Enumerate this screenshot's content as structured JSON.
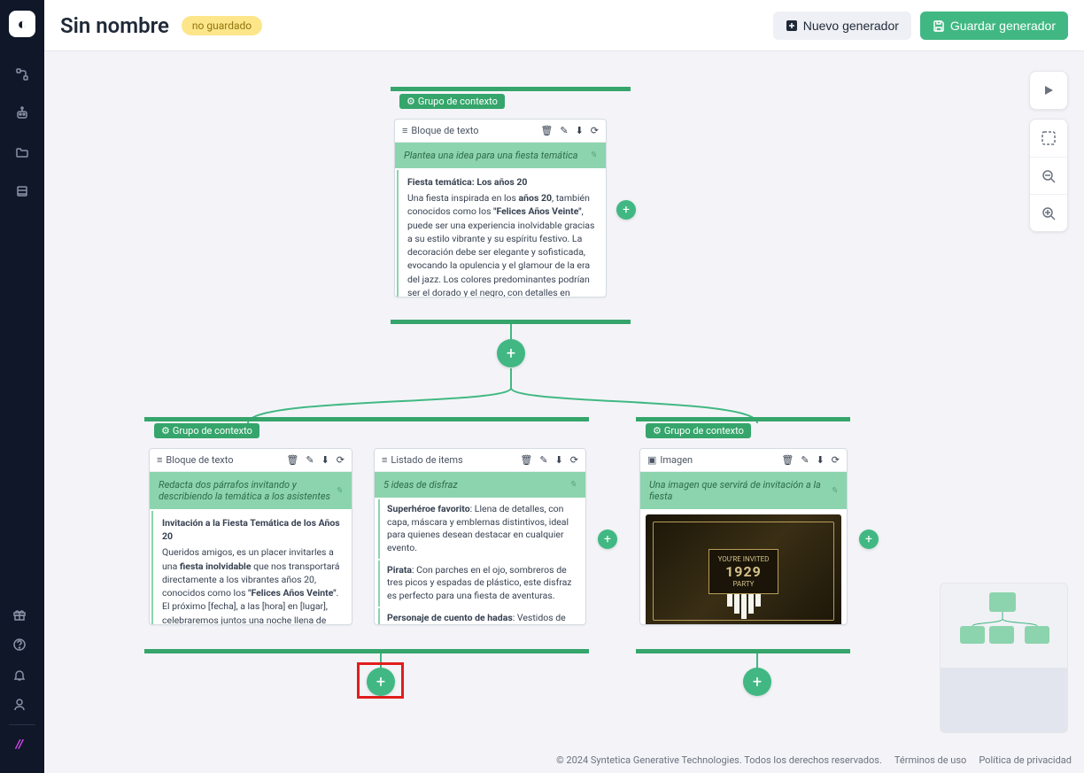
{
  "header": {
    "title": "Sin nombre",
    "unsaved_label": "no guardado",
    "new_generator": "Nuevo generador",
    "save_generator": "Guardar generador"
  },
  "group_labels": {
    "context_group": "Grupo de contexto"
  },
  "block_types": {
    "text_block": "Bloque de texto",
    "item_list": "Listado de items",
    "image": "Imagen"
  },
  "nodes": {
    "top": {
      "prompt": "Plantea una idea para una fiesta temática",
      "title": "Fiesta temática: Los años 20",
      "body_pre": "Una fiesta inspirada en los ",
      "bold1": "años 20",
      "body_mid1": ", también conocidos como los ",
      "bold2": "\"Felices Años Veinte\"",
      "body_post": ", puede ser una experiencia inolvidable gracias a su estilo vibrante y su espíritu festivo. La decoración debe ser elegante y sofisticada, evocando la opulencia y el glamour de la era del jazz. Los colores predominantes podrían ser el dorado y el negro, con detalles en blanco y plata para darle un toque más lujoso. Se pueden usar elementos decorativos como plumas, perlas, luces tenues y cortinas de cuentas para"
    },
    "left": {
      "prompt": "Redacta dos párrafos invitando y describiendo la temática a los asistentes",
      "title": "Invitación a la Fiesta Temática de los Años 20",
      "body_pre": "Queridos amigos, es un placer invitarles a una ",
      "bold1": "fiesta inolvidable",
      "body_mid1": " que nos transportará directamente a los vibrantes años 20, conocidos como los ",
      "bold2": "\"Felices Años Veinte\"",
      "body_post": ". El próximo [fecha], a las [hora] en [lugar], celebraremos juntos una noche llena de elegancia, glamour y mucho jazz. Prepárense para sumergirse en la opulencia de la era del charlestón, donde la decoración, la música y las actividades los harán sentir como en una auténtica fiesta de esa década. Les pedimos que vengan vestidos con la moda de los"
    },
    "middle": {
      "prompt": "5 ideas de disfraz",
      "items": [
        {
          "name": "Superhéroe favorito",
          "desc": ": Llena de detalles, con capa, máscara y emblemas distintivos, ideal para quienes desean destacar en cualquier evento."
        },
        {
          "name": "Pirata",
          "desc": ": Con parches en el ojo, sombreros de tres picos y espadas de plástico, este disfraz es perfecto para una fiesta de aventuras."
        },
        {
          "name": "Personaje de cuento de hadas",
          "desc": ": Vestidos de princesas, dragones o hadas con alitas y varitas mágicas, siempre un clásico para cualquier temática."
        }
      ]
    },
    "right": {
      "prompt": "Una imagen que servirá de invitación a la fiesta",
      "inv_top": "YOU'RE INVITED",
      "inv_year": "1929",
      "inv_party": "PARTY"
    }
  },
  "footer": {
    "copyright": "© 2024 Syntetica Generative Technologies. Todos los derechos reservados.",
    "terms": "Términos de uso",
    "privacy": "Política de privacidad"
  }
}
